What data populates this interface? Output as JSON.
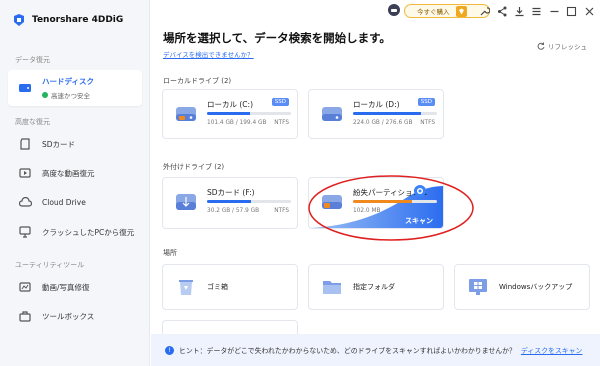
{
  "app": {
    "name": "Tenorshare 4DDiG"
  },
  "sidebar": {
    "section_recovery": "データ復元",
    "active": {
      "label": "ハードディスク",
      "status": "高速かつ安全"
    },
    "section_advanced": "高度な復元",
    "advanced_items": [
      {
        "label": "SDカード",
        "icon": "sd-card-icon"
      },
      {
        "label": "高度な動画復元",
        "icon": "video-icon"
      },
      {
        "label": "Cloud Drive",
        "icon": "cloud-icon"
      },
      {
        "label": "クラッシュしたPCから復元",
        "icon": "crashed-pc-icon"
      }
    ],
    "section_utility": "ユーティリティツール",
    "utility_items": [
      {
        "label": "動画/写真修復",
        "icon": "repair-icon"
      },
      {
        "label": "ツールボックス",
        "icon": "toolbox-icon"
      }
    ]
  },
  "topbar": {
    "buy_label": "今すぐ購入"
  },
  "main": {
    "title": "場所を選択して、データ検索を開始します。",
    "device_link": "デバイスを検出できませんか？",
    "refresh": "リフレッシュ",
    "local_label": "ローカルドライブ (2)",
    "external_label": "外付けドライブ (2)",
    "location_label": "場所",
    "local_drives": [
      {
        "name": "ローカル (C:)",
        "badge": "SSD",
        "size": "101.4 GB / 199.4 GB",
        "fs": "NTFS",
        "used": 0.51
      },
      {
        "name": "ローカル (D:)",
        "badge": "SSD",
        "size": "224.0 GB / 276.6 GB",
        "fs": "NTFS",
        "used": 0.81
      }
    ],
    "external_drives": [
      {
        "name": "SDカード (F:)",
        "size": "30.2 GB / 57.9 GB",
        "fs": "NTFS",
        "used": 0.52
      },
      {
        "name": "紛失パーティション-1",
        "size": "102.0 MB",
        "scan": "スキャン",
        "used": 0.7
      }
    ],
    "locations": [
      {
        "label": "ゴミ箱",
        "icon": "recycle-bin-icon"
      },
      {
        "label": "指定フォルダ",
        "icon": "folder-icon"
      },
      {
        "label": "Windowsバックアップ",
        "icon": "windows-backup-icon"
      }
    ]
  },
  "hint": {
    "text": "ヒント：データがどこで失われたかわからないため、どのドライブをスキャンすればよいかわかりませんか？",
    "link": "ディスクをスキャン"
  },
  "colors": {
    "accent": "#2a6cf0",
    "orange": "#f08a1e",
    "annotation": "#e02020"
  }
}
